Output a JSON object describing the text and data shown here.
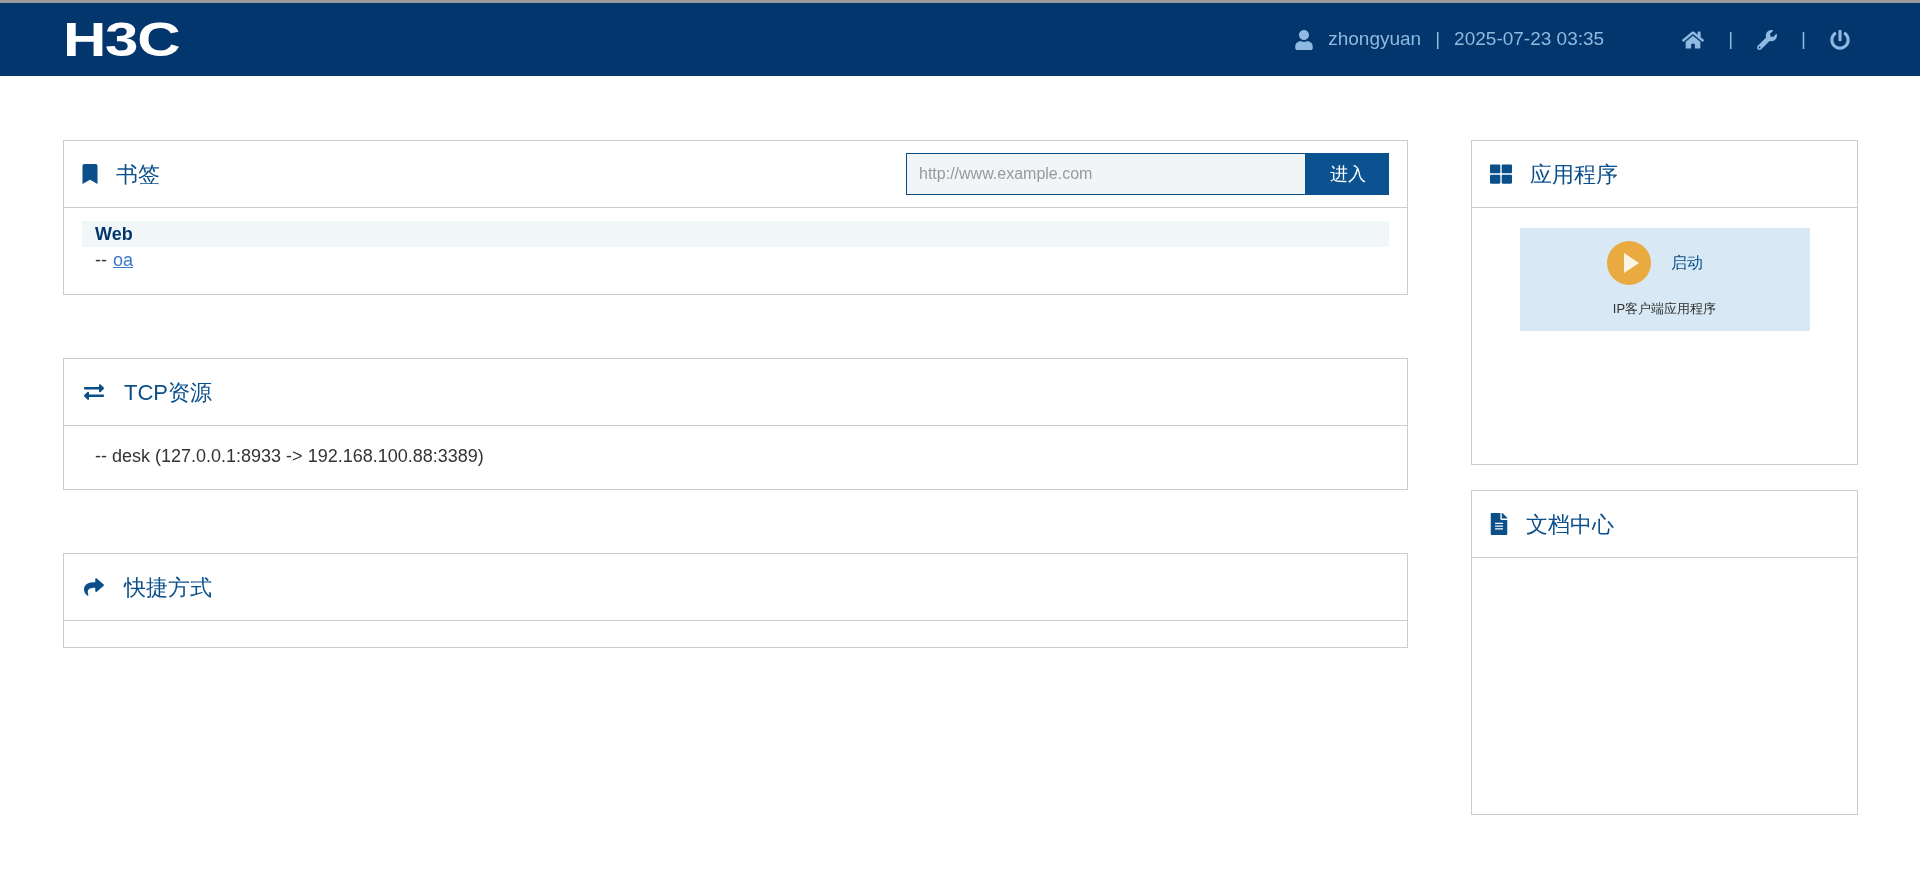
{
  "header": {
    "logo": "H3C",
    "user": "zhongyuan",
    "separator": "|",
    "datetime": "2025-07-23 03:35",
    "nav_separators": [
      "|",
      "|"
    ]
  },
  "bookmarks": {
    "title": "书签",
    "url_field": {
      "placeholder": "http://www.example.com"
    },
    "go_button": "进入",
    "groups": [
      {
        "name": "Web",
        "links": [
          {
            "prefix": "--",
            "label": "oa"
          }
        ]
      }
    ]
  },
  "tcp_resources": {
    "title": "TCP资源",
    "items": [
      "-- desk (127.0.0.1:8933 -> 192.168.100.88:3389)"
    ]
  },
  "shortcuts": {
    "title": "快捷方式"
  },
  "applications": {
    "title": "应用程序",
    "items": [
      {
        "action": "启动",
        "name": "IP客户端应用程序"
      }
    ]
  },
  "documents": {
    "title": "文档中心"
  }
}
